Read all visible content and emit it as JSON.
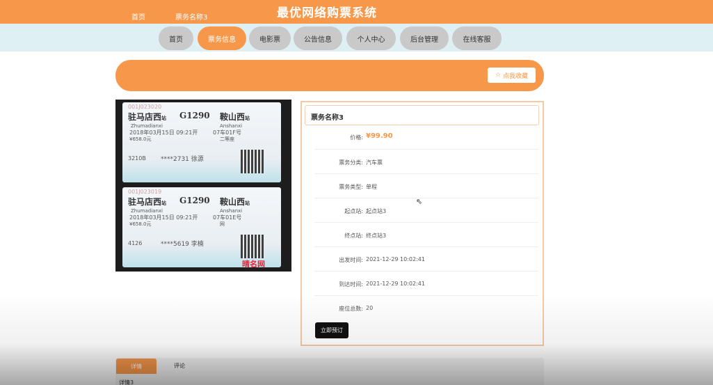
{
  "site": {
    "title": "最优网络购票系统"
  },
  "nav": {
    "items": [
      {
        "label": "首页"
      },
      {
        "label": "票务信息"
      },
      {
        "label": "电影票"
      },
      {
        "label": "公告信息"
      },
      {
        "label": "个人中心"
      },
      {
        "label": "后台管理"
      },
      {
        "label": "在线客服"
      }
    ],
    "active_index": 1
  },
  "breadcrumb": {
    "home": "首页",
    "current": "票务名称3"
  },
  "favorite_button": {
    "label": "点我收藏",
    "icon": "star-outline-icon"
  },
  "ticket_image": {
    "tickets": [
      {
        "number": "001J023020",
        "from": "驻马店西",
        "from_suffix": "站",
        "train": "G1290",
        "to": "鞍山西",
        "to_suffix": "站",
        "from_pinyin": "Zhumadianxi",
        "to_pinyin": "Anshanxi",
        "date": "2018年03月15日 09:21开",
        "seat": "07车01F号",
        "price": "¥658.0元",
        "seat_class": "二等座",
        "serial": "3210B",
        "id_mask": "****2731 徐源"
      },
      {
        "number": "001J023019",
        "from": "驻马店西",
        "from_suffix": "站",
        "train": "G1290",
        "to": "鞍山西",
        "to_suffix": "站",
        "from_pinyin": "Zhumadianxi",
        "to_pinyin": "Anshanxi",
        "date": "2018年03月15日 09:21开",
        "seat": "07车01E号",
        "price": "¥658.0元",
        "seat_class": "网",
        "serial": "4126",
        "id_mask": "****5619 李楠"
      }
    ],
    "watermark": "晴名网"
  },
  "detail": {
    "title": "票务名称3",
    "rows": [
      {
        "label": "价格:",
        "value": "¥99.90"
      },
      {
        "label": "票务分类:",
        "value": "汽车票"
      },
      {
        "label": "票务类型:",
        "value": "单程"
      },
      {
        "label": "起点站:",
        "value": "起点站3"
      },
      {
        "label": "终点站:",
        "value": "终点站3"
      },
      {
        "label": "出发时间:",
        "value": "2021-12-29 10:02:41"
      },
      {
        "label": "到达时间:",
        "value": "2021-12-29 10:02:41"
      },
      {
        "label": "座位总数:",
        "value": "20"
      }
    ],
    "book_button": "立即预订"
  },
  "tabs": {
    "items": [
      {
        "label": "详情"
      },
      {
        "label": "评论"
      }
    ],
    "content": "详情3"
  },
  "colors": {
    "accent": "#f7974a",
    "nav_band": "#dff0f4",
    "pill": "#c9c9c9"
  }
}
